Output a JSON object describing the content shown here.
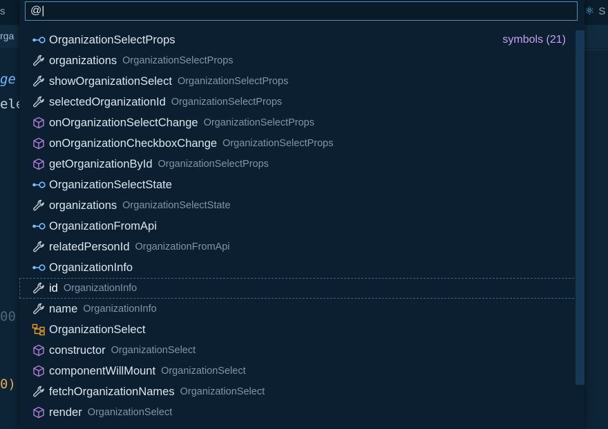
{
  "background": {
    "tab_left_text": "s",
    "tab_right_text": "S",
    "crumb_text": "rga",
    "code_lines": [
      "ge",
      "ele",
      "00",
      "0)"
    ]
  },
  "quick_pick": {
    "input_value": "@|",
    "group_label": "symbols (21)",
    "items": [
      {
        "icon": "interface-icon",
        "label": "OrganizationSelectProps",
        "description": ""
      },
      {
        "icon": "wrench-icon",
        "label": "organizations",
        "description": "OrganizationSelectProps"
      },
      {
        "icon": "wrench-icon",
        "label": "showOrganizationSelect",
        "description": "OrganizationSelectProps"
      },
      {
        "icon": "wrench-icon",
        "label": "selectedOrganizationId",
        "description": "OrganizationSelectProps"
      },
      {
        "icon": "cube-icon",
        "label": "onOrganizationSelectChange",
        "description": "OrganizationSelectProps"
      },
      {
        "icon": "cube-icon",
        "label": "onOrganizationCheckboxChange",
        "description": "OrganizationSelectProps"
      },
      {
        "icon": "cube-icon",
        "label": "getOrganizationById",
        "description": "OrganizationSelectProps"
      },
      {
        "icon": "interface-icon",
        "label": "OrganizationSelectState",
        "description": ""
      },
      {
        "icon": "wrench-icon",
        "label": "organizations",
        "description": "OrganizationSelectState"
      },
      {
        "icon": "interface-icon",
        "label": "OrganizationFromApi",
        "description": ""
      },
      {
        "icon": "wrench-icon",
        "label": "relatedPersonId",
        "description": "OrganizationFromApi"
      },
      {
        "icon": "interface-icon",
        "label": "OrganizationInfo",
        "description": ""
      },
      {
        "icon": "wrench-icon",
        "label": "id",
        "description": "OrganizationInfo"
      },
      {
        "icon": "wrench-icon",
        "label": "name",
        "description": "OrganizationInfo"
      },
      {
        "icon": "class-icon",
        "label": "OrganizationSelect",
        "description": ""
      },
      {
        "icon": "cube-icon",
        "label": "constructor",
        "description": "OrganizationSelect"
      },
      {
        "icon": "cube-icon",
        "label": "componentWillMount",
        "description": "OrganizationSelect"
      },
      {
        "icon": "wrench-icon",
        "label": "fetchOrganizationNames",
        "description": "OrganizationSelect"
      },
      {
        "icon": "cube-icon",
        "label": "render",
        "description": "OrganizationSelect"
      }
    ],
    "selected_index": 12,
    "colors": {
      "interface": "#75beff",
      "wrench": "#c5cfd8",
      "cube": "#b180d7",
      "class": "#ee9d28",
      "group_label": "#c9a0f0"
    }
  }
}
